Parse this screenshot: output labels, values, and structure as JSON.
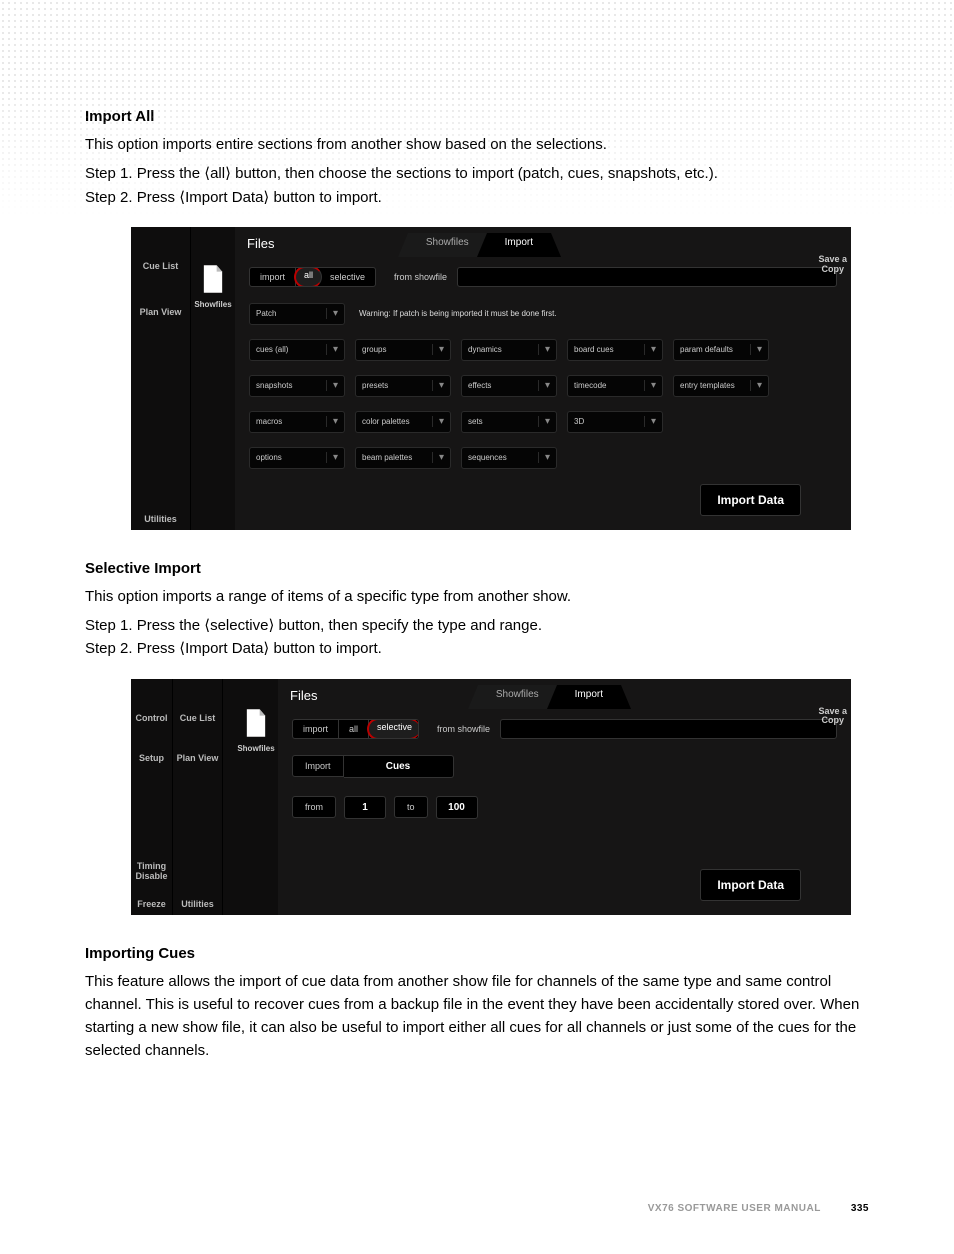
{
  "section1": {
    "heading": "Import All",
    "intro": "This option imports entire sections from another show based on the selections.",
    "steps": [
      "Step   1.  Press the ⟨all⟩ button, then choose the sections to import (patch, cues, snapshots, etc.).",
      "Step   2.  Press ⟨Import Data⟩ button to import."
    ]
  },
  "ss1": {
    "sidebar": [
      "Cue List",
      "Plan View"
    ],
    "sidebar_bottom": "Utilities",
    "files_title": "Files",
    "tab_inactive": "Showfiles",
    "tab_active": "Import",
    "save_a": "Save a",
    "copy": "Copy",
    "showfiles_caption": "Showfiles",
    "seg_import": "import",
    "seg_all": "all",
    "seg_selective": "selective",
    "from_showfile": "from showfile",
    "warning": "Warning: If patch is being imported it must be done first.",
    "options": {
      "r1": [
        "Patch"
      ],
      "r2": [
        "cues (all)",
        "groups",
        "dynamics",
        "board cues",
        "param defaults"
      ],
      "r3": [
        "snapshots",
        "presets",
        "effects",
        "timecode",
        "entry templates"
      ],
      "r4": [
        "macros",
        "color palettes",
        "sets",
        "3D"
      ],
      "r5": [
        "options",
        "beam palettes",
        "sequences"
      ]
    },
    "import_data": "Import Data"
  },
  "section2": {
    "heading": "Selective Import",
    "intro": "This option imports a range of items of a specific type from another show.",
    "steps": [
      "Step   1.  Press the ⟨selective⟩ button, then specify the type and range.",
      "Step   2.  Press ⟨Import Data⟩ button to import."
    ]
  },
  "ss2": {
    "outer_sidebar": {
      "control": "Control",
      "setup": "Setup",
      "timing_disable": "Timing\nDisable",
      "freeze": "Freeze"
    },
    "sidebar": [
      "Cue List",
      "Plan View"
    ],
    "sidebar_bottom": "Utilities",
    "files_title": "Files",
    "tab_inactive": "Showfiles",
    "tab_active": "Import",
    "save_a": "Save a",
    "copy": "Copy",
    "showfiles_caption": "Showfiles",
    "seg_import": "import",
    "seg_all": "all",
    "seg_selective": "selective",
    "from_showfile": "from showfile",
    "import_label": "Import",
    "import_type": "Cues",
    "from_label": "from",
    "from_val": "1",
    "to_label": "to",
    "to_val": "100",
    "import_data": "Import Data"
  },
  "section3": {
    "heading": "Importing Cues",
    "body": "This feature allows the import of cue data from another show file for channels of the same type and same control channel. This is useful to recover cues from a backup file in the event they have been accidentally stored over. When starting a new show file, it can also be useful to import either all cues for all channels or just some of the cues for the selected channels."
  },
  "footer": {
    "manual": "VX76 SOFTWARE USER MANUAL",
    "page": "335"
  }
}
